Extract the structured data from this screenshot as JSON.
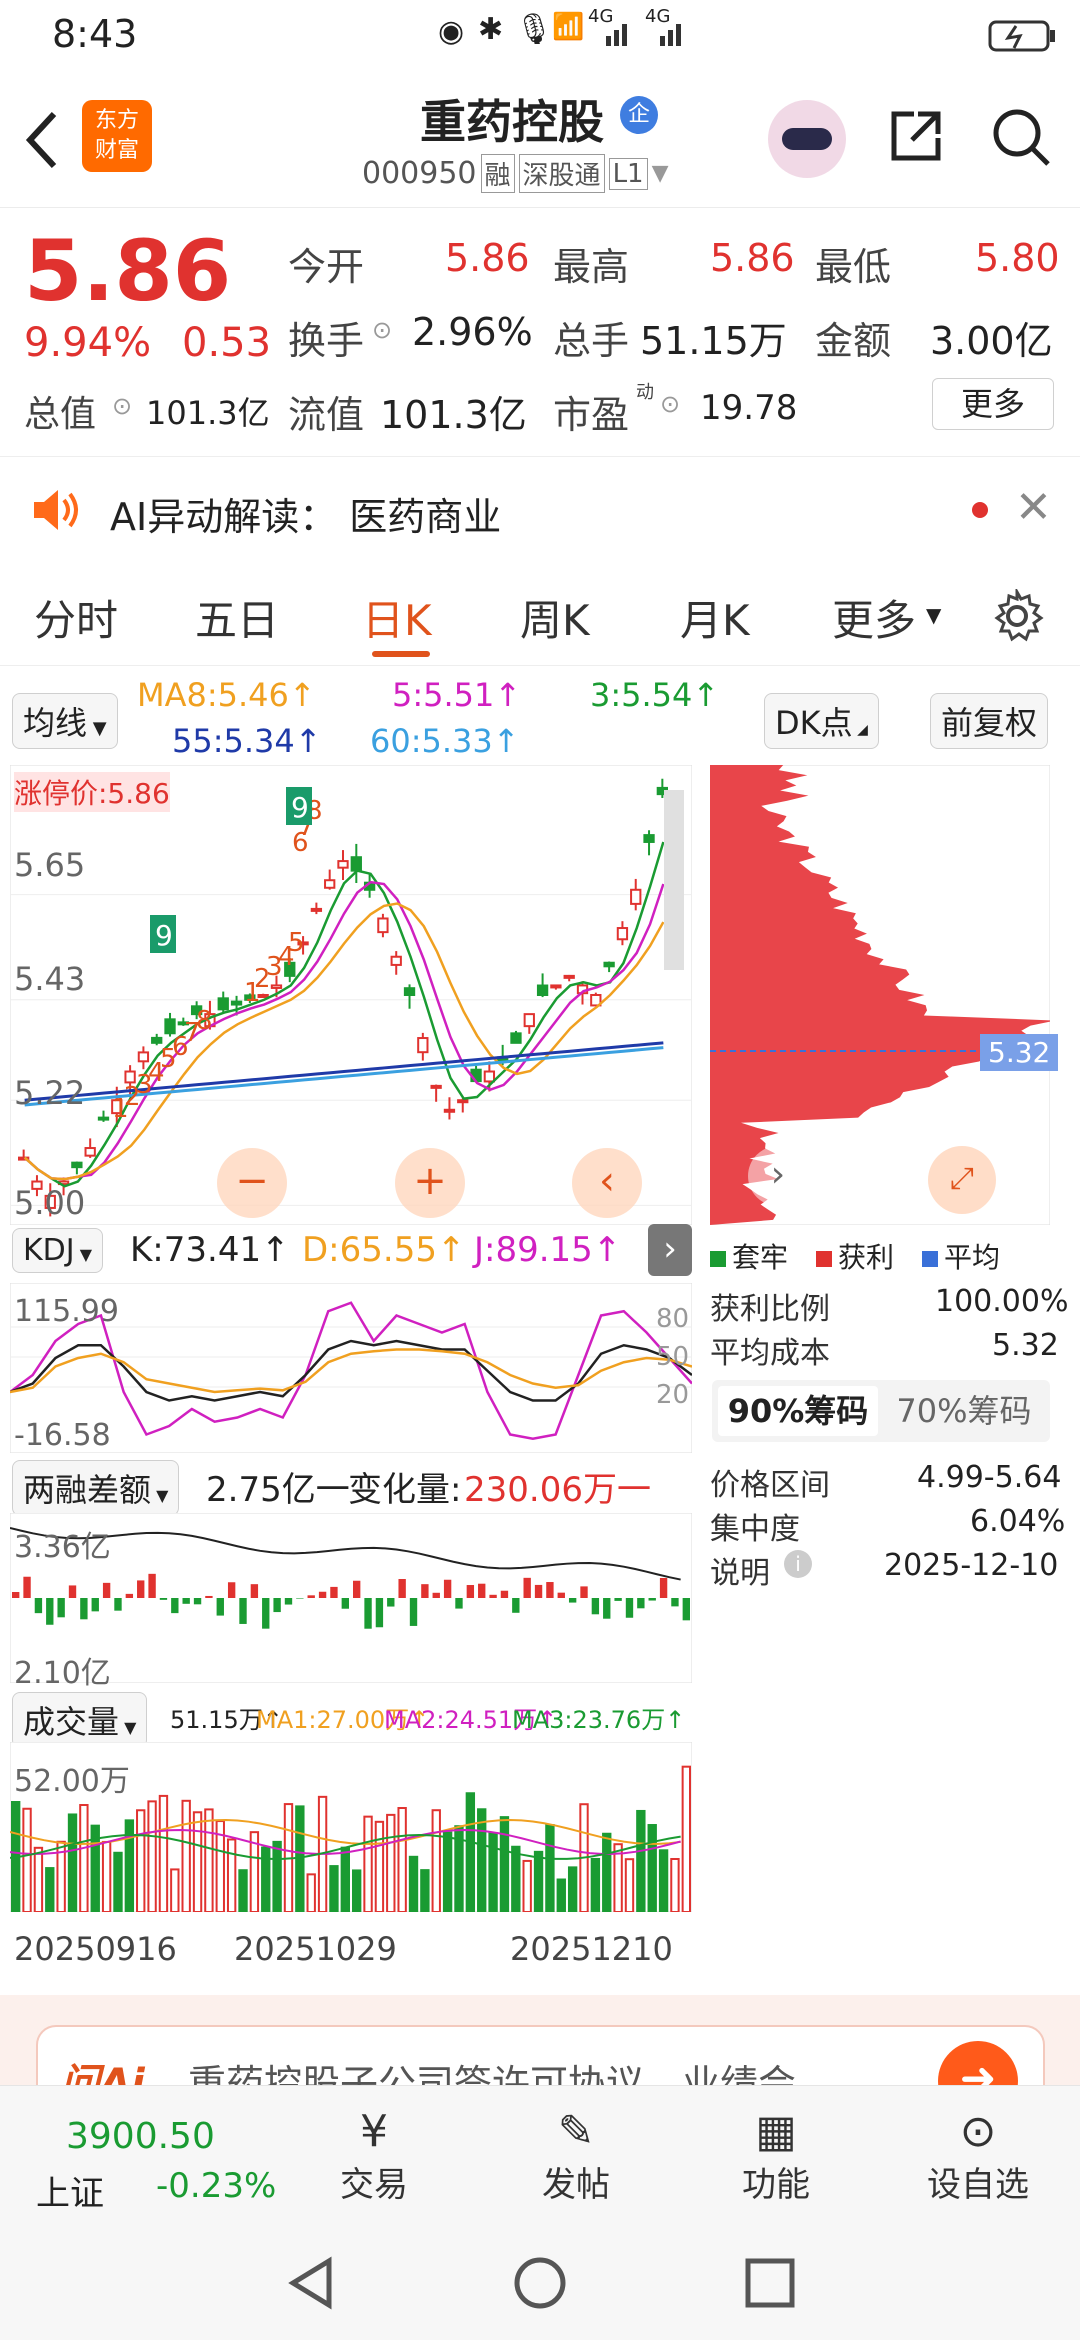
{
  "status": {
    "time": "8:43",
    "network1": "4G",
    "network2": "4G"
  },
  "header": {
    "title": "重药控股",
    "title_badge": "企",
    "code": "000950",
    "tags": [
      "融",
      "深股通",
      "L1"
    ],
    "logo_line1": "东方",
    "logo_line2": "财富"
  },
  "quote": {
    "price": "5.86",
    "change_pct": "9.94%",
    "change_abs": "0.53",
    "market_cap_label": "总值",
    "market_cap": "101.3亿",
    "stats": [
      {
        "label": "今开",
        "value": "5.86"
      },
      {
        "label": "最高",
        "value": "5.86"
      },
      {
        "label": "最低",
        "value": "5.80"
      },
      {
        "label": "换手",
        "value": "2.96%"
      },
      {
        "label": "总手",
        "value": "51.15万"
      },
      {
        "label": "金额",
        "value": "3.00亿"
      },
      {
        "label": "流值",
        "value": "101.3亿"
      },
      {
        "label": "市盈",
        "value": "19.78"
      }
    ],
    "pe_badge": "动",
    "more_label": "更多"
  },
  "ai_banner": {
    "text": "AI异动解读：  医药商业"
  },
  "tabs": [
    "分时",
    "五日",
    "日K",
    "周K",
    "月K",
    "更多"
  ],
  "active_tab": "日K",
  "ma": {
    "selector": "均线",
    "ma8": "MA8:5.46↑",
    "ma5": "5:5.51↑",
    "ma3": "3:5.54↑",
    "ma55": "55:5.34↑",
    "ma60": "60:5.33↑",
    "dk": "DK点",
    "fq": "前复权"
  },
  "kline": {
    "limit_label": "涨停价:5.86",
    "y_labels": [
      "5.65",
      "5.43",
      "5.22",
      "5.00"
    ],
    "y_values": [
      5.65,
      5.43,
      5.22,
      5.0
    ],
    "td_seq_red": [
      "1",
      "2",
      "3",
      "4",
      "5",
      "6",
      "7",
      "8",
      "1",
      "2",
      "3",
      "4",
      "5",
      "6",
      "7",
      "8"
    ],
    "td_badges": [
      "9",
      "9"
    ]
  },
  "chips": {
    "avg_label": "5.32",
    "legend": [
      "套牢",
      "获利",
      "平均"
    ],
    "rows": [
      {
        "label": "获利比例",
        "value": "100.00%"
      },
      {
        "label": "平均成本",
        "value": "5.32"
      }
    ],
    "tab90": "90%筹码",
    "tab70": "70%筹码",
    "details": [
      {
        "label": "价格区间",
        "value": "4.99-5.64"
      },
      {
        "label": "集中度",
        "value": "6.04%"
      },
      {
        "label": "说明",
        "value": "2025-12-10"
      }
    ]
  },
  "kdj": {
    "name": "KDJ",
    "k": "K:73.41↑",
    "d": "D:65.55↑",
    "j": "J:89.15↑",
    "y_top": "115.99",
    "y_bottom": "-16.58",
    "levels": [
      "80",
      "50",
      "20"
    ]
  },
  "margin": {
    "name": "两融差额",
    "value": "2.75亿一",
    "change_label": "变化量:",
    "change_value": "230.06万一",
    "y_top": "3.36亿",
    "y_bottom": "2.10亿"
  },
  "volume": {
    "name": "成交量",
    "v": "51.15万↑",
    "ma1": "MA1:27.00万↑",
    "ma2": "MA2:24.51万↑",
    "ma3": "MA3:23.76万↑",
    "y_top": "52.00万",
    "dates": [
      "20250916",
      "20251029",
      "20251210"
    ]
  },
  "news": {
    "logo": "问Ai",
    "text": "重药控股子公司签许可协议，业绩会..."
  },
  "bottom": {
    "index_value": "3900.50",
    "index_name": "上证",
    "index_change": "-0.23%",
    "items": [
      "交易",
      "发帖",
      "功能",
      "设自选"
    ]
  }
}
